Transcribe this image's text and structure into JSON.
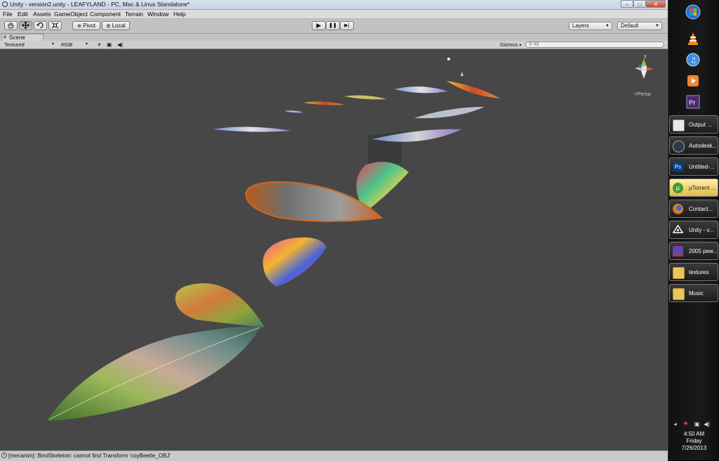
{
  "window": {
    "title": "Unity - version2.unity - LEAFYLAND - PC, Mac & Linux Standalone*",
    "minimize": "–",
    "maximize": "□",
    "close": "✕"
  },
  "menu": [
    "File",
    "Edit",
    "Assets",
    "GameObject",
    "Component",
    "Terrain",
    "Window",
    "Help"
  ],
  "toolbar": {
    "tools": [
      "hand-icon",
      "move-icon",
      "rotate-icon",
      "scale-icon"
    ],
    "pivot_label": "Pivot",
    "local_label": "Local",
    "play": "▶",
    "pause": "❚❚",
    "step": "▶|",
    "layers_label": "Layers",
    "layout_label": "Default"
  },
  "scene": {
    "tab_label": "Scene",
    "render_mode": "Textured",
    "channel": "RGB",
    "gizmos_label": "Gizmos",
    "search_placeholder": "All",
    "persp_label": "Persp",
    "gizmo_y": "y"
  },
  "status": {
    "message": "[mecanim]: BindSkeleton: cannot find Transform 'coyBeetle_OBJ'"
  },
  "taskbar": {
    "pinned": [
      "windows-orb",
      "vlc",
      "itunes",
      "media-player",
      "premiere"
    ],
    "items": [
      {
        "label": "Output ...",
        "icon": "output-icon",
        "active": false
      },
      {
        "label": "Autodesk...",
        "icon": "autodesk-icon",
        "active": false
      },
      {
        "label": "Untitled-...",
        "icon": "photoshop-icon",
        "active": false
      },
      {
        "label": "µTorrent ...",
        "icon": "utorrent-icon",
        "active": true
      },
      {
        "label": "Contact...",
        "icon": "firefox-icon",
        "active": false
      },
      {
        "label": "Unity - v...",
        "icon": "unity-icon",
        "active": false
      },
      {
        "label": "2005 pew...",
        "icon": "winrar-icon",
        "active": false
      },
      {
        "label": "textures",
        "icon": "folder-icon",
        "active": false
      },
      {
        "label": "Music",
        "icon": "folder-icon",
        "active": false
      }
    ],
    "time": "4:50 AM",
    "day": "Friday",
    "date": "7/26/2013"
  },
  "colors": {
    "viewport_bg": "#474747",
    "taskbar_bg": "#141414",
    "active_task": "#e9c95e"
  }
}
